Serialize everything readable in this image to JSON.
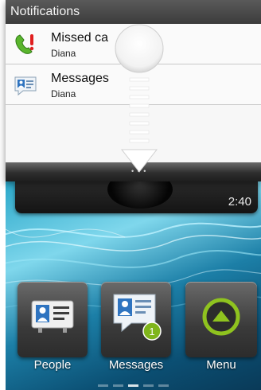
{
  "notifications": {
    "header": "Notifications",
    "items": [
      {
        "title": "Missed ca",
        "subtitle": "Diana",
        "icon": "missed-call-icon"
      },
      {
        "title": "Messages",
        "subtitle": "Diana",
        "icon": "message-icon"
      }
    ]
  },
  "clock": {
    "time": "2:40"
  },
  "home": {
    "tiles": [
      {
        "label": "People",
        "icon": "contact-card-icon"
      },
      {
        "label": "Messages",
        "icon": "message-icon",
        "badge": "1"
      },
      {
        "label": "Menu",
        "icon": "menu-up-arrow-icon"
      }
    ],
    "pages": {
      "count": 5,
      "current": 3
    }
  },
  "colors": {
    "badge": "#7fb51b",
    "menu_ring": "#8fc31f",
    "shade_header": "#4a4a4a"
  }
}
